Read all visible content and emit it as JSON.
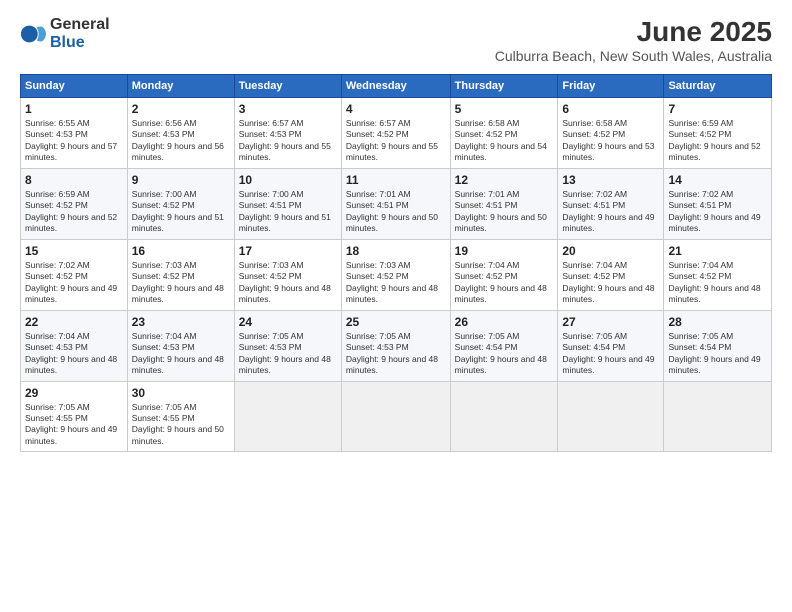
{
  "logo": {
    "general": "General",
    "blue": "Blue"
  },
  "title": "June 2025",
  "location": "Culburra Beach, New South Wales, Australia",
  "weekdays": [
    "Sunday",
    "Monday",
    "Tuesday",
    "Wednesday",
    "Thursday",
    "Friday",
    "Saturday"
  ],
  "weeks": [
    [
      {
        "day": "1",
        "sunrise": "6:55 AM",
        "sunset": "4:53 PM",
        "daylight": "9 hours and 57 minutes."
      },
      {
        "day": "2",
        "sunrise": "6:56 AM",
        "sunset": "4:53 PM",
        "daylight": "9 hours and 56 minutes."
      },
      {
        "day": "3",
        "sunrise": "6:57 AM",
        "sunset": "4:53 PM",
        "daylight": "9 hours and 55 minutes."
      },
      {
        "day": "4",
        "sunrise": "6:57 AM",
        "sunset": "4:52 PM",
        "daylight": "9 hours and 55 minutes."
      },
      {
        "day": "5",
        "sunrise": "6:58 AM",
        "sunset": "4:52 PM",
        "daylight": "9 hours and 54 minutes."
      },
      {
        "day": "6",
        "sunrise": "6:58 AM",
        "sunset": "4:52 PM",
        "daylight": "9 hours and 53 minutes."
      },
      {
        "day": "7",
        "sunrise": "6:59 AM",
        "sunset": "4:52 PM",
        "daylight": "9 hours and 52 minutes."
      }
    ],
    [
      {
        "day": "8",
        "sunrise": "6:59 AM",
        "sunset": "4:52 PM",
        "daylight": "9 hours and 52 minutes."
      },
      {
        "day": "9",
        "sunrise": "7:00 AM",
        "sunset": "4:52 PM",
        "daylight": "9 hours and 51 minutes."
      },
      {
        "day": "10",
        "sunrise": "7:00 AM",
        "sunset": "4:51 PM",
        "daylight": "9 hours and 51 minutes."
      },
      {
        "day": "11",
        "sunrise": "7:01 AM",
        "sunset": "4:51 PM",
        "daylight": "9 hours and 50 minutes."
      },
      {
        "day": "12",
        "sunrise": "7:01 AM",
        "sunset": "4:51 PM",
        "daylight": "9 hours and 50 minutes."
      },
      {
        "day": "13",
        "sunrise": "7:02 AM",
        "sunset": "4:51 PM",
        "daylight": "9 hours and 49 minutes."
      },
      {
        "day": "14",
        "sunrise": "7:02 AM",
        "sunset": "4:51 PM",
        "daylight": "9 hours and 49 minutes."
      }
    ],
    [
      {
        "day": "15",
        "sunrise": "7:02 AM",
        "sunset": "4:52 PM",
        "daylight": "9 hours and 49 minutes."
      },
      {
        "day": "16",
        "sunrise": "7:03 AM",
        "sunset": "4:52 PM",
        "daylight": "9 hours and 48 minutes."
      },
      {
        "day": "17",
        "sunrise": "7:03 AM",
        "sunset": "4:52 PM",
        "daylight": "9 hours and 48 minutes."
      },
      {
        "day": "18",
        "sunrise": "7:03 AM",
        "sunset": "4:52 PM",
        "daylight": "9 hours and 48 minutes."
      },
      {
        "day": "19",
        "sunrise": "7:04 AM",
        "sunset": "4:52 PM",
        "daylight": "9 hours and 48 minutes."
      },
      {
        "day": "20",
        "sunrise": "7:04 AM",
        "sunset": "4:52 PM",
        "daylight": "9 hours and 48 minutes."
      },
      {
        "day": "21",
        "sunrise": "7:04 AM",
        "sunset": "4:52 PM",
        "daylight": "9 hours and 48 minutes."
      }
    ],
    [
      {
        "day": "22",
        "sunrise": "7:04 AM",
        "sunset": "4:53 PM",
        "daylight": "9 hours and 48 minutes."
      },
      {
        "day": "23",
        "sunrise": "7:04 AM",
        "sunset": "4:53 PM",
        "daylight": "9 hours and 48 minutes."
      },
      {
        "day": "24",
        "sunrise": "7:05 AM",
        "sunset": "4:53 PM",
        "daylight": "9 hours and 48 minutes."
      },
      {
        "day": "25",
        "sunrise": "7:05 AM",
        "sunset": "4:53 PM",
        "daylight": "9 hours and 48 minutes."
      },
      {
        "day": "26",
        "sunrise": "7:05 AM",
        "sunset": "4:54 PM",
        "daylight": "9 hours and 48 minutes."
      },
      {
        "day": "27",
        "sunrise": "7:05 AM",
        "sunset": "4:54 PM",
        "daylight": "9 hours and 49 minutes."
      },
      {
        "day": "28",
        "sunrise": "7:05 AM",
        "sunset": "4:54 PM",
        "daylight": "9 hours and 49 minutes."
      }
    ],
    [
      {
        "day": "29",
        "sunrise": "7:05 AM",
        "sunset": "4:55 PM",
        "daylight": "9 hours and 49 minutes."
      },
      {
        "day": "30",
        "sunrise": "7:05 AM",
        "sunset": "4:55 PM",
        "daylight": "9 hours and 50 minutes."
      },
      null,
      null,
      null,
      null,
      null
    ]
  ],
  "labels": {
    "sunrise": "Sunrise:",
    "sunset": "Sunset:",
    "daylight": "Daylight:"
  }
}
